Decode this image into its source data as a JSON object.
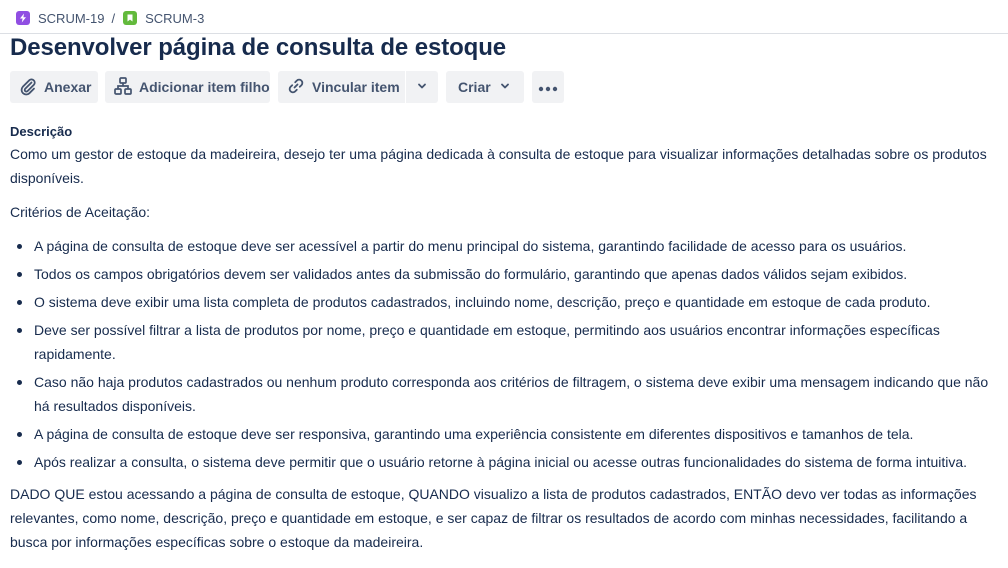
{
  "breadcrumb": {
    "epic": {
      "label": "SCRUM-19",
      "icon": "epic-lightning-icon",
      "color": "#904ee2"
    },
    "separator": "/",
    "story": {
      "label": "SCRUM-3",
      "icon": "story-bookmark-icon",
      "color": "#63ba3c"
    }
  },
  "issue": {
    "title": "Desenvolver página de consulta de estoque"
  },
  "toolbar": {
    "attach_label": "Anexar",
    "add_child_label": "Adicionar item filho",
    "link_label": "Vincular item",
    "create_label": "Criar"
  },
  "description": {
    "heading": "Descrição",
    "intro": "Como um gestor de estoque da madeireira, desejo ter uma página dedicada à consulta de estoque para visualizar informações detalhadas sobre os produtos disponíveis.",
    "criteria_heading": "Critérios de Aceitação:",
    "criteria": [
      "A página de consulta de estoque deve ser acessível a partir do menu principal do sistema, garantindo facilidade de acesso para os usuários.",
      "Todos os campos obrigatórios devem ser validados antes da submissão do formulário, garantindo que apenas dados válidos sejam exibidos.",
      "O sistema deve exibir uma lista completa de produtos cadastrados, incluindo nome, descrição, preço e quantidade em estoque de cada produto.",
      "Deve ser possível filtrar a lista de produtos por nome, preço e quantidade em estoque, permitindo aos usuários encontrar informações específicas rapidamente.",
      "Caso não haja produtos cadastrados ou nenhum produto corresponda aos critérios de filtragem, o sistema deve exibir uma mensagem indicando que não há resultados disponíveis.",
      "A página de consulta de estoque deve ser responsiva, garantindo uma experiência consistente em diferentes dispositivos e tamanhos de tela.",
      "Após realizar a consulta, o sistema deve permitir que o usuário retorne à página inicial ou acesse outras funcionalidades do sistema de forma intuitiva."
    ],
    "scenario": "DADO QUE estou acessando a página de consulta de estoque, QUANDO visualizo a lista de produtos cadastrados, ENTÃO devo ver todas as informações relevantes, como nome, descrição, preço e quantidade em estoque, e ser capaz de filtrar os resultados de acordo com minhas necessidades, facilitando a busca por informações específicas sobre o estoque da madeireira."
  }
}
